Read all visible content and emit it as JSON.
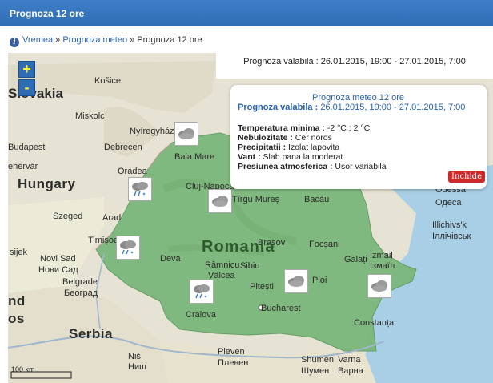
{
  "header": {
    "title": "Prognoza 12 ore"
  },
  "breadcrumb": {
    "home": "Vremea",
    "sep1": " » ",
    "section": "Prognoza meteo",
    "sep2": " » ",
    "current": "Prognoza 12 ore"
  },
  "validity": {
    "text": "Prognoza valabila : 26.01.2015, 19:00 - 27.01.2015, 7:00"
  },
  "popup": {
    "title": "Prognoza meteo 12 ore",
    "validity_label": "Prognoza valabila :",
    "validity_value": "26.01.2015, 19:00 - 27.01.2015, 7:00",
    "temp_label": "Temperatura minima :",
    "temp_value": "-2 °C : 2 °C",
    "cloud_label": "Nebulozitate :",
    "cloud_value": "Cer noros",
    "precip_label": "Precipitatii :",
    "precip_value": "Izolat lapovita",
    "wind_label": "Vant :",
    "wind_value": "Slab pana la moderat",
    "pressure_label": "Presiunea atmosferica :",
    "pressure_value": "Usor variabila",
    "close_label": "Inchide"
  },
  "zoom": {
    "in": "+",
    "out": "-"
  },
  "map": {
    "labels": {
      "slovakia": "Slovakia",
      "kosice": "Košice",
      "miskolc": "Miskolc",
      "nyiregyhaza": "Nyíregyháza",
      "budapest": "Budapest",
      "debrecen": "Debrecen",
      "szekesfeh": "ehérvár",
      "hungary": "Hungary",
      "oradea": "Oradea",
      "baia_mare": "Baia Mare",
      "cluj": "Cluj-Napoca",
      "tirgu": "Tîrgu Mureș",
      "bacau": "Bacău",
      "szeged": "Szeged",
      "arad": "Arad",
      "timisoara": "Timișoara",
      "deva": "Deva",
      "brasov": "Brașov",
      "romania": "Romania",
      "focsani": "Focșani",
      "odessa": "Odessa",
      "odesa": "Одеса",
      "illichivsk": "Illichivs'k",
      "illichivsk_cyr": "Іллічівськ",
      "ramnicu": "Râmnicu",
      "valcea": "Vâlcea",
      "sibiu": "Sibiu",
      "pitesti": "Pitești",
      "ploiesti": "Ploi",
      "galati": "Galați",
      "izmail": "Izmail",
      "izmail_cyr": "Ізмаїл",
      "novi_sad": "Novi Sad",
      "novi_sad_cyr": "Нови Сад",
      "belgrade": "Belgrade",
      "beograd": "Београд",
      "osijek": "sijek",
      "craiova": "Craiova",
      "bucharest": "Bucharest",
      "constanta": "Constanța",
      "serbia": "Serbia",
      "nis": "Niš",
      "nis_cyr": "Ниш",
      "pleven": "Pleven",
      "plevan_cyr": "Плевен",
      "shumen": "Shumen",
      "shumen_cyr": "Шумен",
      "varna": "Varna",
      "varna_cyr": "Варна",
      "slavonski": "nd",
      "sofia": "os",
      "scale": "100 km"
    }
  }
}
